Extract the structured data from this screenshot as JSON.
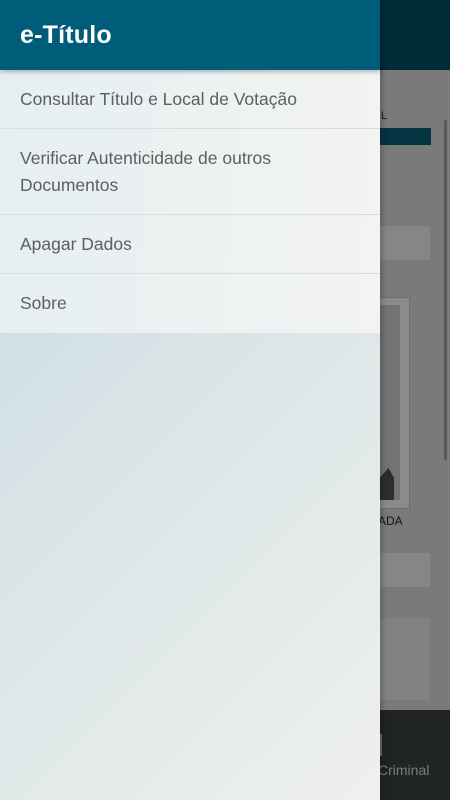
{
  "drawer": {
    "title": "e-Título",
    "items": [
      {
        "label": "Consultar Título e Local de Votação"
      },
      {
        "label": "Verificar Autenticidade de outros Documentos"
      },
      {
        "label": "Apagar Dados"
      },
      {
        "label": "Sobre"
      }
    ]
  },
  "background": {
    "section_label_fragment": "L",
    "photo_caption_fragment": "ADA",
    "bottom_nav_label_fragment": "Criminal"
  },
  "colors": {
    "header": "#005d7a",
    "menu_text": "#5a5f60",
    "accent_bar": "#0b5b74"
  }
}
